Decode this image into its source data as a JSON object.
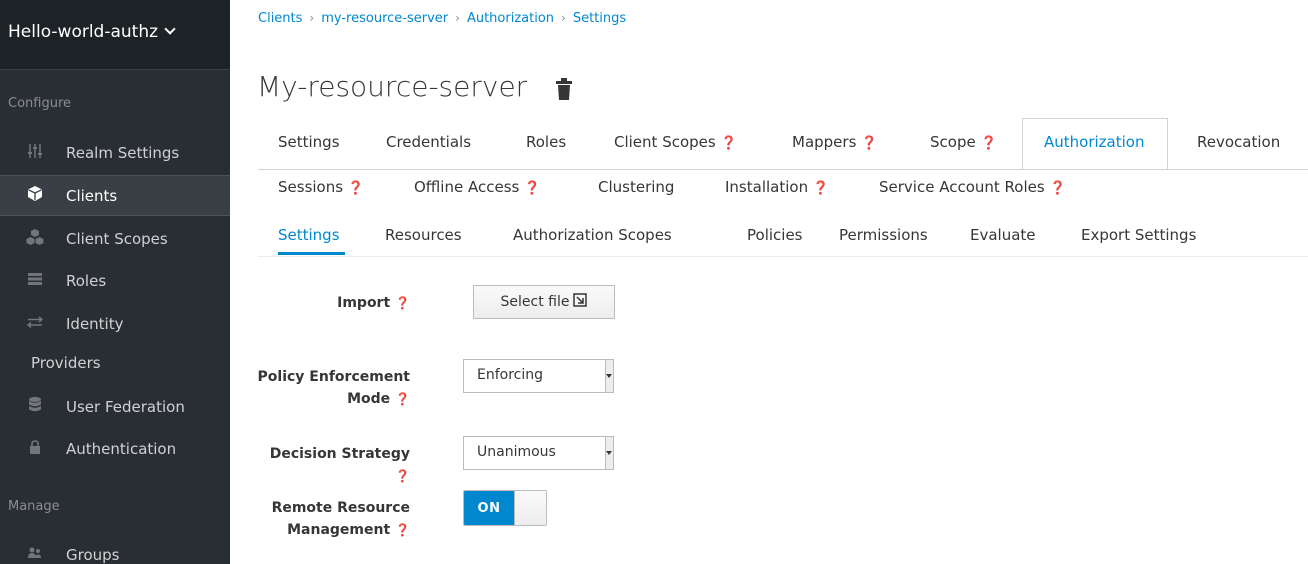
{
  "sidebar": {
    "realm_name": "Hello-world-authz",
    "configure_label": "Configure",
    "manage_label": "Manage",
    "items": [
      {
        "label": "Realm Settings",
        "icon": "sliders-icon"
      },
      {
        "label": "Clients",
        "icon": "cube-icon"
      },
      {
        "label": "Client Scopes",
        "icon": "cubes-icon"
      },
      {
        "label": "Roles",
        "icon": "list-icon"
      },
      {
        "label": "Identity",
        "continuation": "Providers",
        "icon": "exchange-icon"
      },
      {
        "label": "User Federation",
        "icon": "database-icon"
      },
      {
        "label": "Authentication",
        "icon": "lock-icon"
      }
    ],
    "manage_items": [
      {
        "label": "Groups",
        "icon": "users-icon"
      }
    ]
  },
  "breadcrumb": [
    "Clients",
    "my-resource-server",
    "Authorization",
    "Settings"
  ],
  "page_title": "My-resource-server",
  "tabs_row1": [
    "Settings",
    "Credentials",
    "Roles",
    "Client Scopes",
    "Mappers",
    "Scope",
    "Authorization",
    "Revocation"
  ],
  "tabs_row2": [
    "Sessions",
    "Offline Access",
    "Clustering",
    "Installation",
    "Service Account Roles"
  ],
  "subtabs": [
    "Settings",
    "Resources",
    "Authorization Scopes",
    "Policies",
    "Permissions",
    "Evaluate",
    "Export Settings"
  ],
  "form": {
    "import_label": "Import",
    "select_file_label": "Select file",
    "policy_label_line1": "Policy Enforcement",
    "policy_label_line2": "Mode",
    "policy_value": "Enforcing",
    "decision_label": "Decision Strategy",
    "decision_value": "Unanimous",
    "remote_label_line1": "Remote Resource",
    "remote_label_line2": "Management",
    "toggle_label": "ON"
  },
  "colors": {
    "accent": "#0088ce",
    "sidebar_bg": "#292e34"
  }
}
